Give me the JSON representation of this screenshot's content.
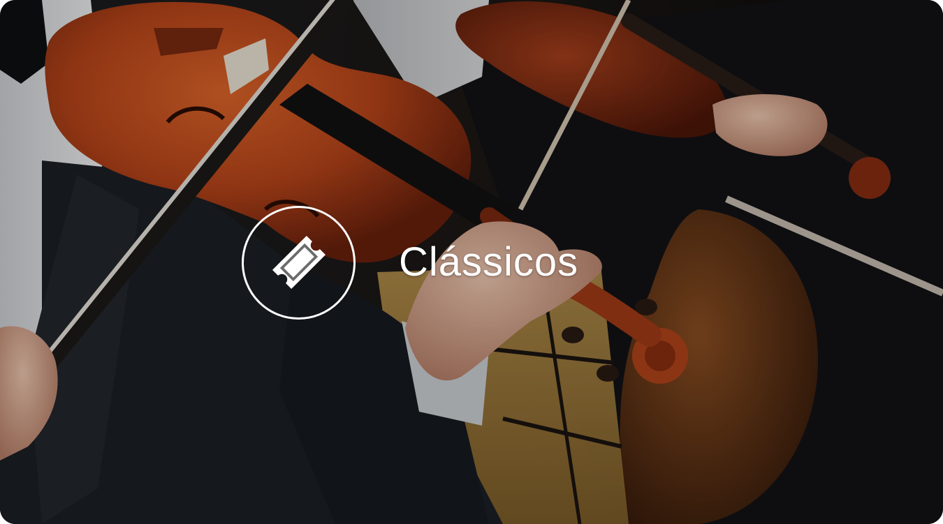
{
  "category": {
    "title": "Clássicos",
    "icon": "ticket-icon"
  },
  "colors": {
    "text": "#ffffff",
    "overlay": "rgba(0,0,0,0.22)",
    "violin": "#b8461a",
    "suit": "#15181d"
  },
  "image": {
    "subject": "violinists-orchestra-photo"
  }
}
